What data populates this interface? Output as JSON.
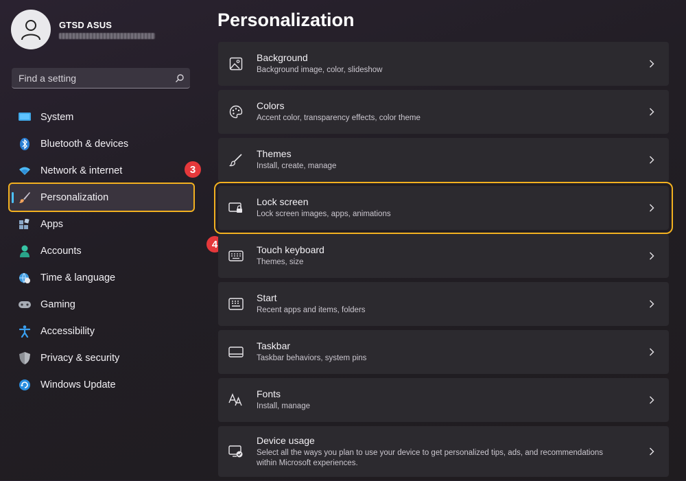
{
  "profile": {
    "name": "GTSD ASUS"
  },
  "search": {
    "placeholder": "Find a setting"
  },
  "sidebar": {
    "items": [
      {
        "label": "System",
        "icon": "monitor-icon"
      },
      {
        "label": "Bluetooth & devices",
        "icon": "bluetooth-icon"
      },
      {
        "label": "Network & internet",
        "icon": "wifi-icon"
      },
      {
        "label": "Personalization",
        "icon": "paintbrush-icon",
        "selected": true
      },
      {
        "label": "Apps",
        "icon": "apps-icon"
      },
      {
        "label": "Accounts",
        "icon": "person-icon"
      },
      {
        "label": "Time & language",
        "icon": "globe-clock-icon"
      },
      {
        "label": "Gaming",
        "icon": "gamepad-icon"
      },
      {
        "label": "Accessibility",
        "icon": "accessibility-icon"
      },
      {
        "label": "Privacy & security",
        "icon": "shield-icon"
      },
      {
        "label": "Windows Update",
        "icon": "update-icon"
      }
    ]
  },
  "annotations": {
    "step_3": "3",
    "step_4": "4"
  },
  "main": {
    "title": "Personalization",
    "cards": [
      {
        "title": "Background",
        "subtitle": "Background image, color, slideshow",
        "icon": "image-icon"
      },
      {
        "title": "Colors",
        "subtitle": "Accent color, transparency effects, color theme",
        "icon": "palette-icon"
      },
      {
        "title": "Themes",
        "subtitle": "Install, create, manage",
        "icon": "brush-icon"
      },
      {
        "title": "Lock screen",
        "subtitle": "Lock screen images, apps, animations",
        "icon": "lock-screen-icon",
        "highlighted": true
      },
      {
        "title": "Touch keyboard",
        "subtitle": "Themes, size",
        "icon": "keyboard-icon"
      },
      {
        "title": "Start",
        "subtitle": "Recent apps and items, folders",
        "icon": "start-icon"
      },
      {
        "title": "Taskbar",
        "subtitle": "Taskbar behaviors, system pins",
        "icon": "taskbar-icon"
      },
      {
        "title": "Fonts",
        "subtitle": "Install, manage",
        "icon": "fonts-icon"
      },
      {
        "title": "Device usage",
        "subtitle": "Select all the ways you plan to use your device to get personalized tips, ads, and recommendations within Microsoft experiences.",
        "icon": "device-usage-icon"
      }
    ]
  },
  "colors": {
    "accent": "#4cc2ff",
    "highlight": "#f3b120",
    "badge": "#e5383b"
  }
}
